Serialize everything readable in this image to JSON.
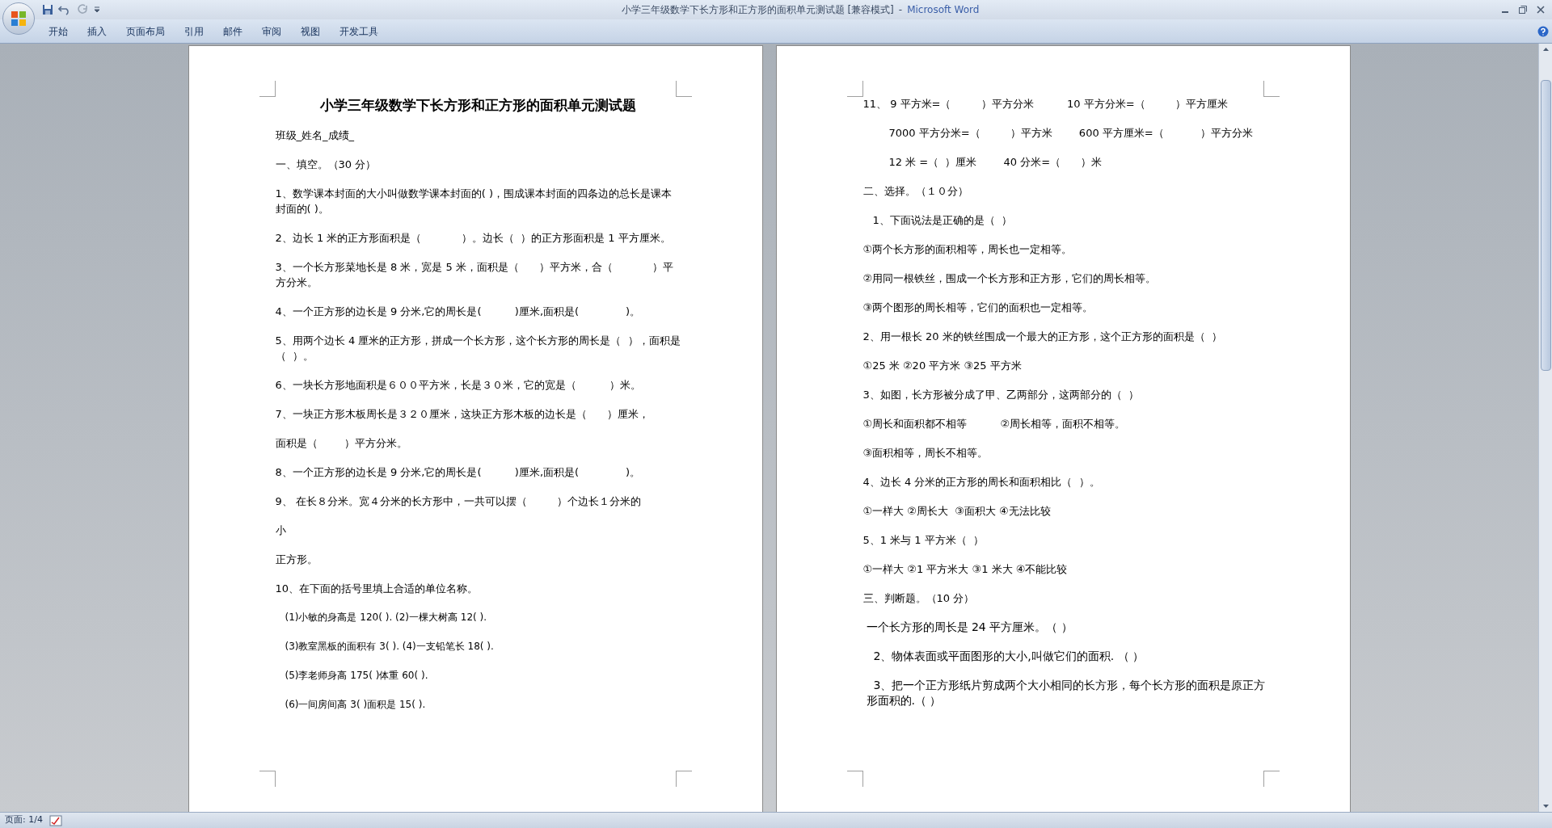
{
  "window": {
    "title": "小学三年级数学下长方形和正方形的面积单元测试题 [兼容模式]",
    "separator": "-",
    "app": "Microsoft Word"
  },
  "ribbon_tabs": [
    {
      "label": "开始"
    },
    {
      "label": "插入"
    },
    {
      "label": "页面布局"
    },
    {
      "label": "引用"
    },
    {
      "label": "邮件"
    },
    {
      "label": "审阅"
    },
    {
      "label": "视图"
    },
    {
      "label": "开发工具"
    }
  ],
  "pages": [
    {
      "paragraphs": [
        {
          "kind": "title",
          "text": "小学三年级数学下长方形和正方形的面积单元测试题"
        },
        {
          "kind": "text",
          "text": "班级_姓名_成绩_"
        },
        {
          "kind": "text",
          "text": "一、填空。（30 分）"
        },
        {
          "kind": "text",
          "text": "1、数学课本封面的大小叫做数学课本封面的( )，围成课本封面的四条边的总长是课本封面的( )。"
        },
        {
          "kind": "text",
          "text": "2、边长 1 米的正方形面积是（            ）。边长（  ）的正方形面积是 1 平方厘米。"
        },
        {
          "kind": "text",
          "text": "3、一个长方形菜地长是 8 米，宽是 5 米，面积是（      ）平方米，合（            ）平方分米。"
        },
        {
          "kind": "text",
          "text": "4、一个正方形的边长是 9 分米,它的周长是(          )厘米,面积是(              )。"
        },
        {
          "kind": "text",
          "text": "5、用两个边长 4 厘米的正方形，拼成一个长方形，这个长方形的周长是（  ），面积是（  ）。"
        },
        {
          "kind": "text",
          "text": "6、一块长方形地面积是６００平方米，长是３０米，它的宽是（          ）米。"
        },
        {
          "kind": "text",
          "text": "7、一块正方形木板周长是３２０厘米，这块正方形木板的边长是（      ）厘米，"
        },
        {
          "kind": "text",
          "text": "面积是（        ）平方分米。"
        },
        {
          "kind": "text",
          "text": "8、一个正方形的边长是 9 分米,它的周长是(          )厘米,面积是(              )。"
        },
        {
          "kind": "text",
          "text": "9、 在长８分米。宽４分米的长方形中，一共可以摆（         ）个边长１分米的"
        },
        {
          "kind": "text",
          "text": "小"
        },
        {
          "kind": "text",
          "text": "正方形。"
        },
        {
          "kind": "text",
          "text": "10、在下面的括号里填上合适的单位名称。"
        },
        {
          "kind": "small",
          "text": "(1)小敏的身高是 120( ). (2)一棵大树高 12( )."
        },
        {
          "kind": "small",
          "text": "(3)教室黑板的面积有 3( ). (4)一支铅笔长 18( )."
        },
        {
          "kind": "small",
          "text": "(5)李老师身高 175( )体重 60( )."
        },
        {
          "kind": "small",
          "text": "(6)一间房间高 3( )面积是 15( )."
        }
      ]
    },
    {
      "paragraphs": [
        {
          "kind": "text",
          "text": "11、 9 平方米=（         ）平方分米          10 平方分米=（         ）平方厘米"
        },
        {
          "kind": "indented",
          "text": "7000 平方分米=（         ）平方米        600 平方厘米=（           ）平方分米"
        },
        {
          "kind": "indented",
          "text": "12 米 =（  ）厘米        40 分米=（      ）米"
        },
        {
          "kind": "text",
          "text": "二、选择。（１０分）"
        },
        {
          "kind": "shifted",
          "text": "1、下面说法是正确的是（  ）"
        },
        {
          "kind": "text",
          "text": "①两个长方形的面积相等，周长也一定相等。"
        },
        {
          "kind": "text",
          "text": "②用同一根铁丝，围成一个长方形和正方形，它们的周长相等。"
        },
        {
          "kind": "text",
          "text": "③两个图形的周长相等，它们的面积也一定相等。"
        },
        {
          "kind": "text",
          "text": "2、用一根长 20 米的铁丝围成一个最大的正方形，这个正方形的面积是（  ）"
        },
        {
          "kind": "text",
          "text": "①25 米 ②20 平方米 ③25 平方米"
        },
        {
          "kind": "text",
          "text": "3、如图，长方形被分成了甲、乙两部分，这两部分的（  ）"
        },
        {
          "kind": "text",
          "text": "①周长和面积都不相等          ②周长相等，面积不相等。"
        },
        {
          "kind": "text",
          "text": "③面积相等，周长不相等。"
        },
        {
          "kind": "text",
          "text": "4、边长 4 分米的正方形的周长和面积相比（  ）。"
        },
        {
          "kind": "text",
          "text": "①一样大 ②周长大  ③面积大 ④无法比较"
        },
        {
          "kind": "text",
          "text": "5、1 米与 1 平方米（  ）"
        },
        {
          "kind": "text",
          "text": "①一样大 ②1 平方米大 ③1 米大 ④不能比较"
        },
        {
          "kind": "text",
          "text": "三、判断题。（10 分）"
        },
        {
          "kind": "large",
          "text": "一个长方形的周长是 24 平方厘米。（ ）"
        },
        {
          "kind": "large",
          "text": "  2、物体表面或平面图形的大小,叫做它们的面积. （ ）"
        },
        {
          "kind": "large",
          "text": "  3、把一个正方形纸片剪成两个大小相同的长方形，每个长方形的面积是原正方形面积的.（ ）"
        }
      ]
    }
  ],
  "status_bar": {
    "page": "页面: 1/4"
  }
}
